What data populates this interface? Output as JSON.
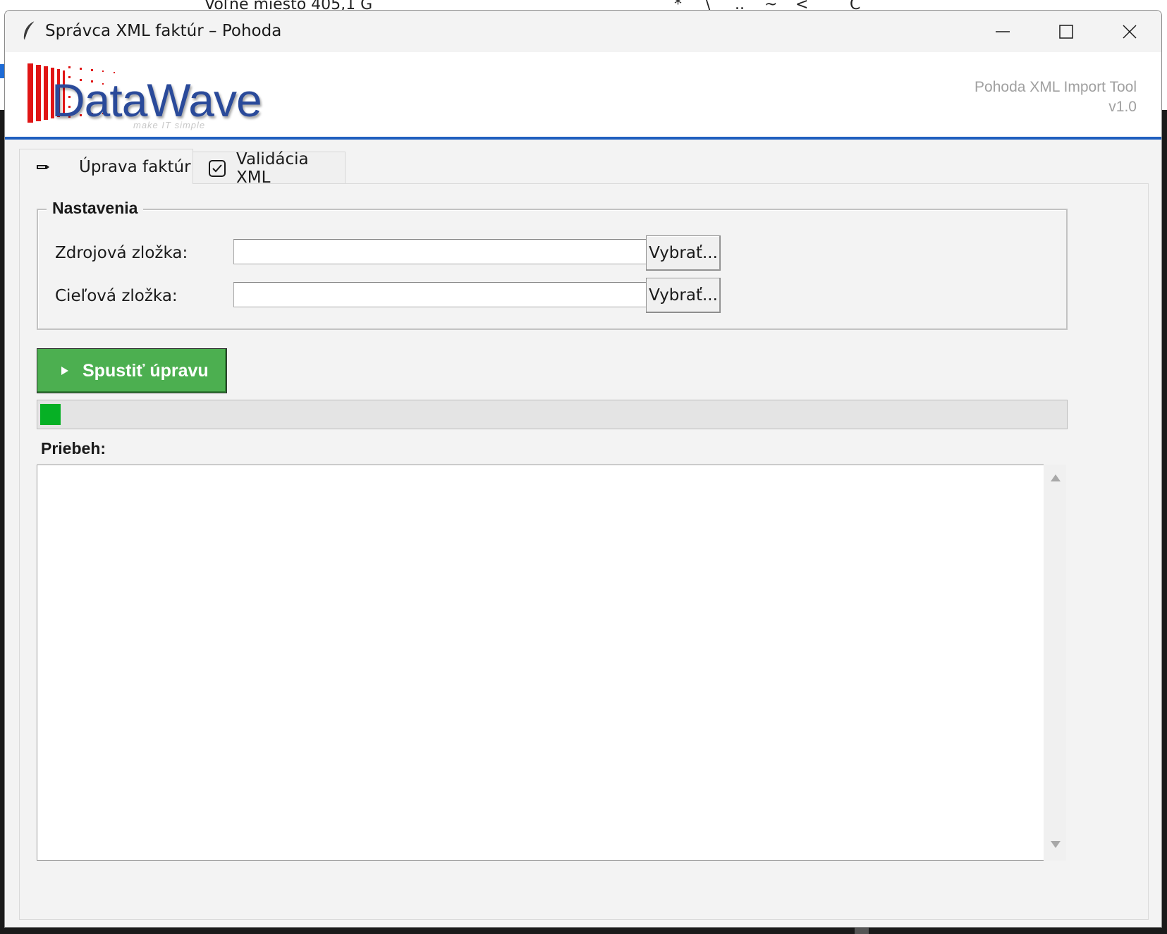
{
  "background": {
    "fragments": [
      "Voľné miesto 405,1 G",
      "*",
      "\\",
      "..",
      "~",
      "<",
      "C"
    ]
  },
  "window": {
    "title": "Správca XML faktúr – Pohoda",
    "controls": {
      "minimize": "minimize",
      "maximize": "maximize",
      "close": "close"
    }
  },
  "header": {
    "logo_text": "DataWave",
    "logo_tagline": "make IT simple",
    "tool_name": "Pohoda XML Import Tool",
    "version": "v1.0",
    "accent_color": "#1f5fbf"
  },
  "tabs": [
    {
      "label": "Úprava faktúr",
      "icon": "pencil-icon",
      "active": true
    },
    {
      "label": "Validácia XML",
      "icon": "checkbox-icon",
      "active": false
    }
  ],
  "settings": {
    "legend": "Nastavenia",
    "source_label": "Zdrojová zložka:",
    "source_value": "",
    "target_label": "Cieľová zložka:",
    "target_value": "",
    "browse_label": "Vybrať..."
  },
  "run": {
    "label": "Spustiť úpravu",
    "color": "#4caf50"
  },
  "progress": {
    "value_percent": 2,
    "color": "#06b025"
  },
  "log": {
    "label": "Priebeh:",
    "content": ""
  }
}
